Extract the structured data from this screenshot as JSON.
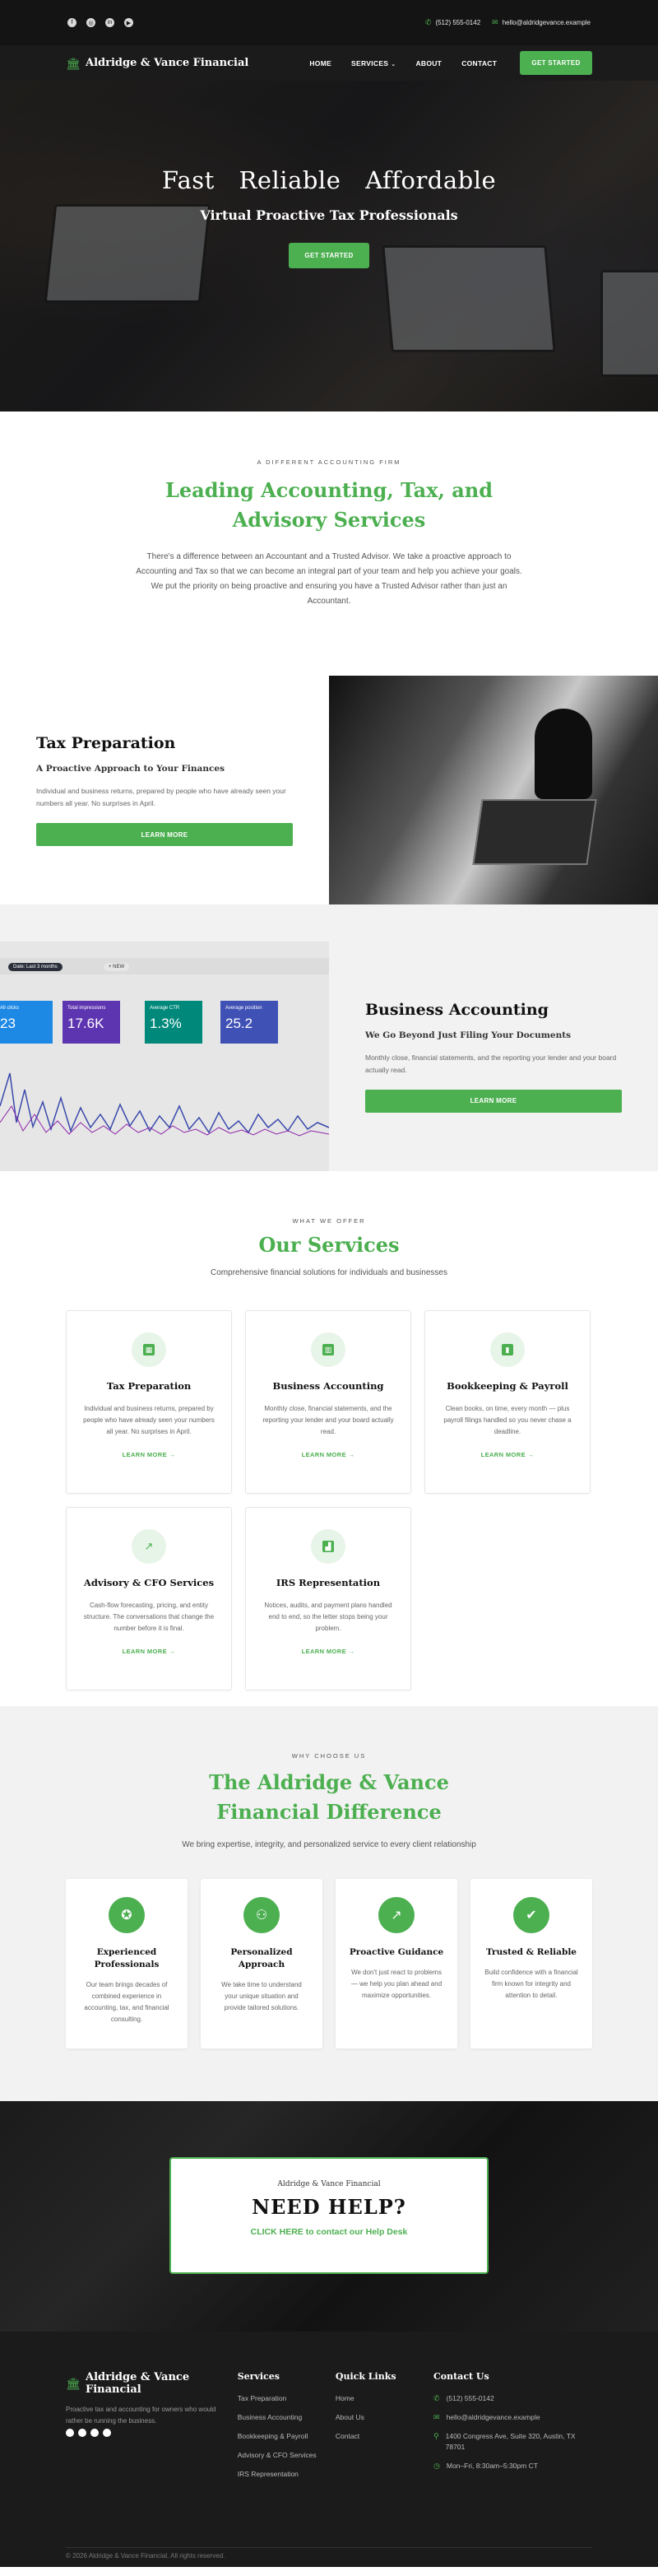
{
  "topbar": {
    "socials": [
      "facebook-icon",
      "instagram-icon",
      "linkedin-icon",
      "youtube-icon"
    ],
    "phone": "(512) 555-0142",
    "email": "hello@aldridgevance.example"
  },
  "nav": {
    "brand": "Aldridge & Vance Financial",
    "items": [
      {
        "label": "HOME"
      },
      {
        "label": "SERVICES"
      },
      {
        "label": "ABOUT"
      },
      {
        "label": "CONTACT"
      }
    ],
    "cta": "GET STARTED"
  },
  "hero": {
    "title": "Fast Reliable Affordable",
    "subtitle": "Virtual Proactive Tax Professionals",
    "button": "GET STARTED"
  },
  "intro": {
    "eyebrow": "A DIFFERENT ACCOUNTING FIRM",
    "title": "Leading Accounting, Tax, and Advisory Services",
    "body": "There's a difference between an Accountant and a Trusted Advisor. We take a proactive approach to Accounting and Tax so that we can become an integral part of your team and help you achieve your goals. We put the priority on being proactive and ensuring you have a Trusted Advisor rather than just an Accountant."
  },
  "tax": {
    "title": "Tax Preparation",
    "subtitle": "A Proactive Approach to Your Finances",
    "body": "Individual and business returns, prepared by people who have already seen your numbers all year. No surprises in April.",
    "button": "LEARN MORE"
  },
  "accounting": {
    "title": "Business Accounting",
    "subtitle": "We Go Beyond Just Filing Your Documents",
    "body": "Monthly close, financial statements, and the reporting your lender and your board actually read.",
    "button": "LEARN MORE",
    "dashboard": {
      "pill1": "Date: Last 3 months",
      "pill2": "+ NEW",
      "tiles": [
        {
          "label": "All clicks",
          "value": "23",
          "color": "#1e88e5"
        },
        {
          "label": "Total impressions",
          "value": "17.6K",
          "color": "#5e35b1"
        },
        {
          "label": "Average CTR",
          "value": "1.3%",
          "color": "#00897b"
        },
        {
          "label": "Average position",
          "value": "25.2",
          "color": "#3f51b5"
        }
      ]
    }
  },
  "services": {
    "eyebrow": "WHAT WE OFFER",
    "title": "Our Services",
    "lead": "Comprehensive financial solutions for individuals and businesses",
    "more_label": "LEARN MORE →",
    "cards": [
      {
        "icon": "calculator-icon",
        "title": "Tax Preparation",
        "body": "Individual and business returns, prepared by people who have already seen your numbers all year. No surprises in April."
      },
      {
        "icon": "building-icon",
        "title": "Business Accounting",
        "body": "Monthly close, financial statements, and the reporting your lender and your board actually read."
      },
      {
        "icon": "book-icon",
        "title": "Bookkeeping & Payroll",
        "body": "Clean books, on time, every month — plus payroll filings handled so you never chase a deadline."
      },
      {
        "icon": "trend-up-icon",
        "title": "Advisory & CFO Services",
        "body": "Cash-flow forecasting, pricing, and entity structure. The conversations that change the number before it is final."
      },
      {
        "icon": "chart-icon",
        "title": "IRS Representation",
        "body": "Notices, audits, and payment plans handled end to end, so the letter stops being your problem."
      }
    ]
  },
  "difference": {
    "eyebrow": "WHY CHOOSE US",
    "title": "The Aldridge & Vance Financial Difference",
    "lead": "We bring expertise, integrity, and personalized service to every client relationship",
    "cards": [
      {
        "icon": "medal-icon",
        "title": "Experienced Professionals",
        "body": "Our team brings decades of combined experience in accounting, tax, and financial consulting."
      },
      {
        "icon": "people-icon",
        "title": "Personalized Approach",
        "body": "We take time to understand your unique situation and provide tailored solutions."
      },
      {
        "icon": "trend-up-icon",
        "title": "Proactive Guidance",
        "body": "We don't just react to problems — we help you plan ahead and maximize opportunities."
      },
      {
        "icon": "shield-check-icon",
        "title": "Trusted & Reliable",
        "body": "Build confidence with a financial firm known for integrity and attention to detail."
      }
    ]
  },
  "help": {
    "small": "Aldridge & Vance Financial",
    "title": "NEED HELP?",
    "link": "CLICK HERE to contact our Help Desk"
  },
  "footer": {
    "brand": "Aldridge & Vance Financial",
    "tagline": "Proactive tax and accounting for owners who would rather be running the business.",
    "services_title": "Services",
    "services": [
      "Tax Preparation",
      "Business Accounting",
      "Bookkeeping & Payroll",
      "Advisory & CFO Services",
      "IRS Representation"
    ],
    "links_title": "Quick Links",
    "links": [
      "Home",
      "About Us",
      "Contact"
    ],
    "contact_title": "Contact Us",
    "contact": [
      {
        "icon": "phone-icon",
        "text": "(512) 555-0142"
      },
      {
        "icon": "mail-icon",
        "text": "hello@aldridgevance.example"
      },
      {
        "icon": "location-icon",
        "text": "1400 Congress Ave, Suite 320, Austin, TX 78701"
      },
      {
        "icon": "clock-icon",
        "text": "Mon–Fri, 8:30am–5:30pm CT"
      }
    ],
    "copyright": "© 2026 Aldridge & Vance Financial. All rights reserved."
  }
}
